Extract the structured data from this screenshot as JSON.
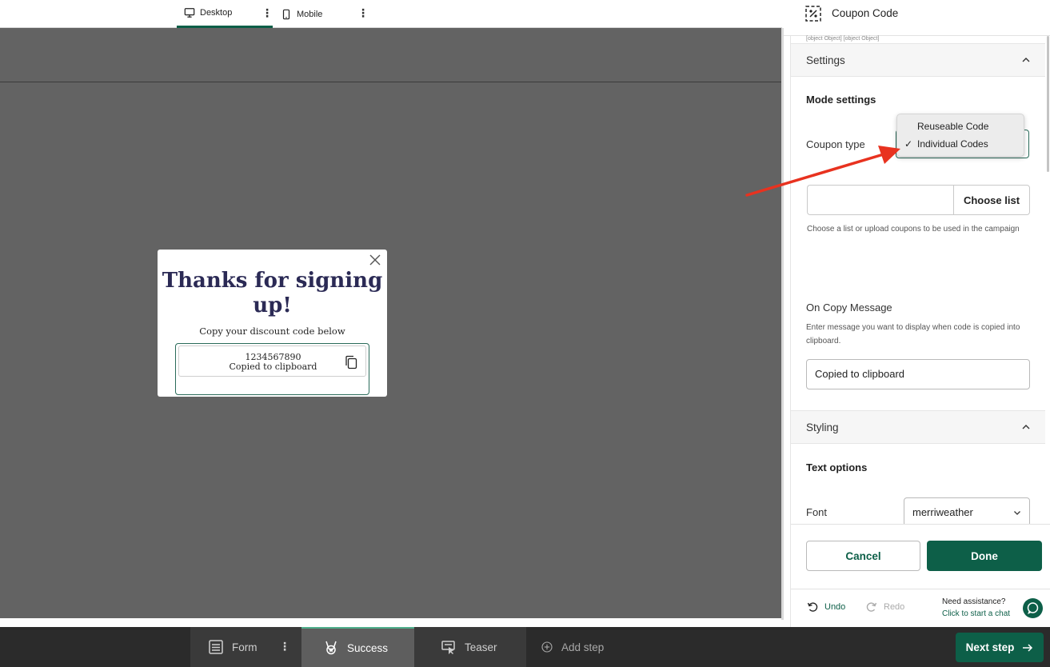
{
  "device_bar": {
    "desktop_label": "Desktop",
    "mobile_label": "Mobile"
  },
  "popup": {
    "title": "Thanks for signing up!",
    "subtitle": "Copy your discount code below",
    "code": "1234567890",
    "copied_message": "Copied to clipboard"
  },
  "steps": {
    "form_label": "Form",
    "success_label": "Success",
    "teaser_label": "Teaser",
    "add_step_label": "Add step",
    "next_step_label": "Next step"
  },
  "panel": {
    "title": "Coupon Code",
    "object_text": "[object Object] [object Object]",
    "settings_section": "Settings",
    "mode_settings": "Mode settings",
    "coupon_type_label": "Coupon type",
    "coupon_type_options": [
      "Reuseable Code",
      "Individual Codes"
    ],
    "coupon_type_selected": "Individual Codes",
    "choose_list_label": "Choose list",
    "choose_list_help": "Choose a list or upload coupons to be used in the campaign",
    "on_copy_label": "On Copy Message",
    "on_copy_help": "Enter message you want to display when code is copied into clipboard.",
    "on_copy_value": "Copied to clipboard",
    "styling_section": "Styling",
    "text_options": "Text options",
    "font_label": "Font",
    "font_value": "merriweather",
    "cancel_label": "Cancel",
    "done_label": "Done",
    "undo_label": "Undo",
    "redo_label": "Redo",
    "assist_title": "Need assistance?",
    "assist_link": "Click to start a chat"
  },
  "colors": {
    "brand_green": "#0d5f48",
    "canvas_gray": "#636363",
    "popup_title": "#2b2a55",
    "annotation_red": "#e8321f"
  }
}
